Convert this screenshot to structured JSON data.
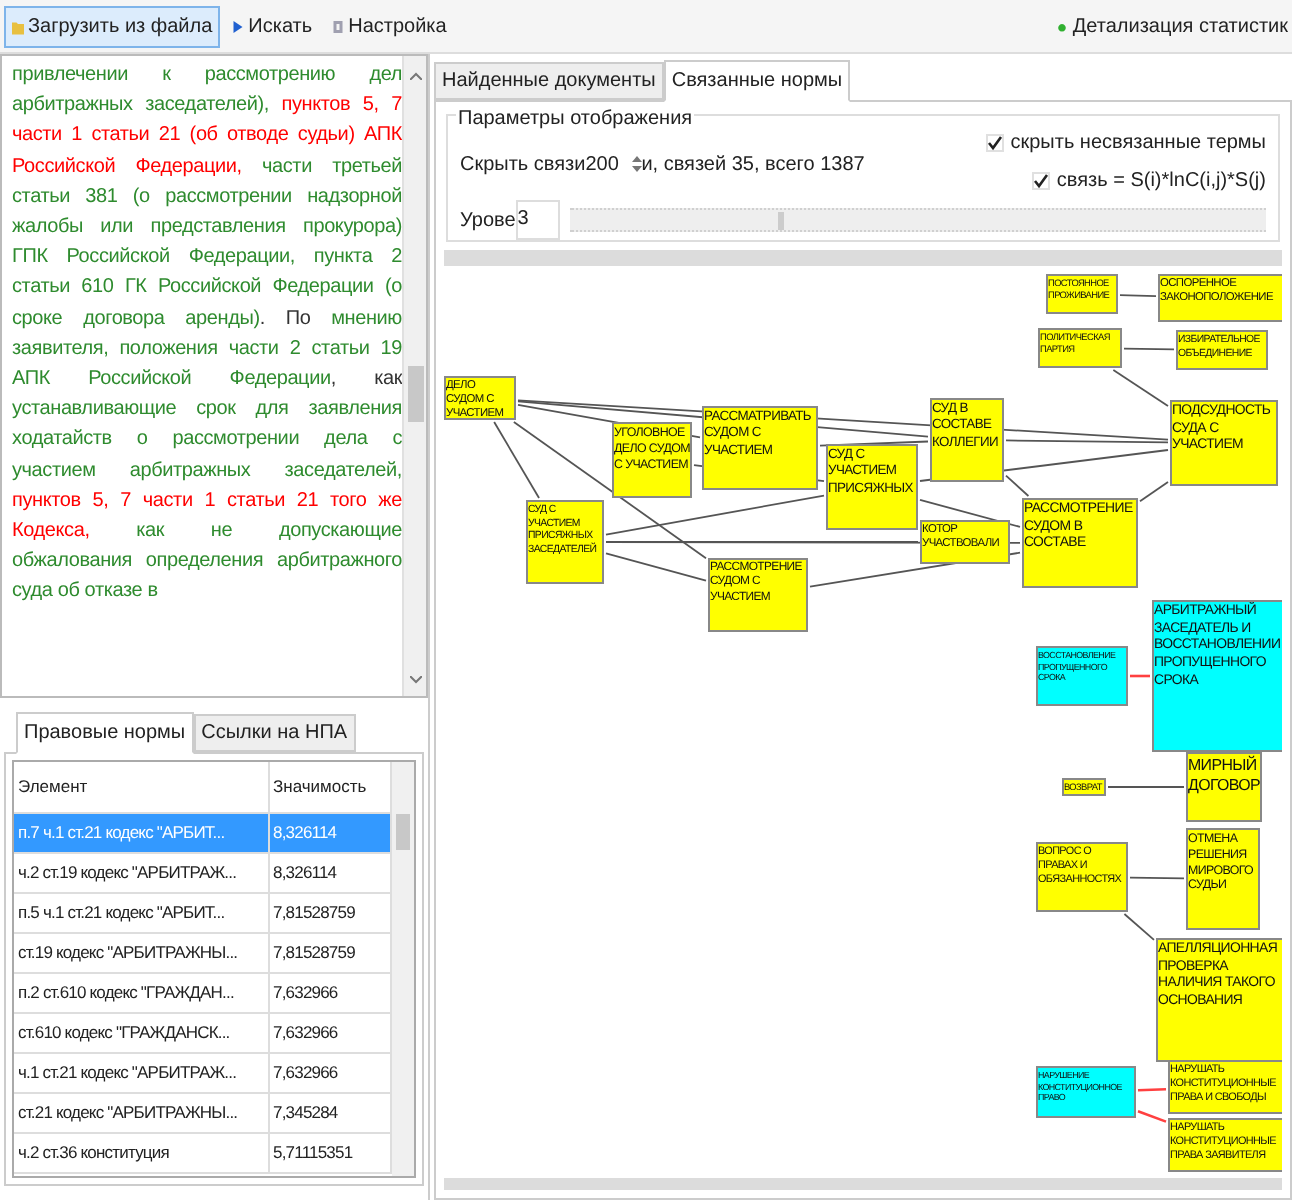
{
  "toolbar": {
    "buttons": [
      {
        "label": "Загрузить из файла",
        "selected": true
      },
      {
        "label": "Искать",
        "selected": false
      },
      {
        "label": "Настройка",
        "selected": false
      }
    ],
    "right_button": {
      "label": "Детализация статистик"
    }
  },
  "document_text": {
    "segments": [
      {
        "text": "привлечении к рассмотрению дел арбитражных заседателей), ",
        "color": "#2e8b2e"
      },
      {
        "text": "пунктов 5, 7 части 1 статьи 21 (об отводе судьи) АПК Российской Федерации, ",
        "color": "#ff0000"
      },
      {
        "text": "части третьей статьи 381 (о рассмотрении надзорной жалобы или представления прокурора) ГПК Российской Федерации, ",
        "color": "#2e8b2e"
      },
      {
        "text": "пункта 2 статьи 610 ГК Российской Федерации (о сроке договора аренды)",
        "color": "#2e8b2e"
      },
      {
        "text": ". По ",
        "color": "#333333"
      },
      {
        "text": "мнению заявителя, положения части 2 статьи 19 АПК Российской Федерации",
        "color": "#2e8b2e"
      },
      {
        "text": ", как ",
        "color": "#333333"
      },
      {
        "text": "устанавливающие срок для заявления ходатайств о рассмотрении дела с участием арбитражных заседателей, ",
        "color": "#2e8b2e"
      },
      {
        "text": "пунктов 5, 7 части 1 статьи 21 того же Кодекса, ",
        "color": "#ff0000"
      },
      {
        "text": "как не допускающие обжалования определения арбитражного суда об отказе в",
        "color": "#2e8b2e"
      }
    ]
  },
  "left_tabs": [
    {
      "label": "Правовые нормы",
      "selected": true
    },
    {
      "label": "Ссылки на НПА",
      "selected": false
    }
  ],
  "table": {
    "columns": [
      "Элемент",
      "Значимость"
    ],
    "rows": [
      {
        "cells": [
          "п.7 ч.1 ст.21 кодекс \"АРБИТ...",
          "8,326114"
        ],
        "selected": true
      },
      {
        "cells": [
          "ч.2 ст.19 кодекс \"АРБИТРАЖ...",
          "8,326114"
        ],
        "selected": false
      },
      {
        "cells": [
          "п.5 ч.1 ст.21 кодекс \"АРБИТ...",
          "7,81528759"
        ],
        "selected": false
      },
      {
        "cells": [
          "ст.19 кодекс \"АРБИТРАЖНЫ...",
          "7,81528759"
        ],
        "selected": false
      },
      {
        "cells": [
          "п.2 ст.610 кодекс \"ГРАЖДАН...",
          "7,632966"
        ],
        "selected": false
      },
      {
        "cells": [
          "ст.610 кодекс \"ГРАЖДАНСК...",
          "7,632966"
        ],
        "selected": false
      },
      {
        "cells": [
          "ч.1 ст.21 кодекс \"АРБИТРАЖ...",
          "7,632966"
        ],
        "selected": false
      },
      {
        "cells": [
          "ст.21 кодекс \"АРБИТРАЖНЫ...",
          "7,345284"
        ],
        "selected": false
      },
      {
        "cells": [
          "ч.2 ст.36 конституция",
          "5,71115351"
        ],
        "selected": false
      }
    ]
  },
  "right_tabs": [
    {
      "label": "Найденные документы",
      "selected": false
    },
    {
      "label": "Связанные нормы",
      "selected": true
    }
  ],
  "display_params": {
    "title": "Параметры отображения",
    "hide_links_label": "Скрыть связи",
    "hide_links_value": "200",
    "links_info": "и, связей 35, всего 1387",
    "level_label": "Урове",
    "level_value": "3",
    "slider": {
      "level": 0.3
    },
    "checkboxes": [
      {
        "label": "скрыть несвязанные термы",
        "checked": true
      },
      {
        "label": "связь = S(i)*lnC(i,j)*S(j)",
        "checked": true
      }
    ]
  },
  "graph": {
    "nodes": [
      {
        "label": "ПОСТОЯННОЕ ПРОЖИВАНИЕ",
        "color": "#ffff00"
      },
      {
        "label": "ОСПОРЕННОЕ ЗАКОНОПОЛОЖЕНИЕ",
        "color": "#ffff00"
      },
      {
        "label": "ПОЛИТИЧЕСКАЯ ПАРТИЯ",
        "color": "#ffff00"
      },
      {
        "label": "ИЗБИРАТЕЛЬНОЕ ОБЪЕДИНЕНИЕ",
        "color": "#ffff00"
      },
      {
        "label": "ДЕЛО СУДОМ С УЧАСТИЕМ",
        "color": "#ffff00"
      },
      {
        "label": "УГОЛОВНОЕ ДЕЛО СУДОМ С УЧАСТИЕМ",
        "color": "#ffff00"
      },
      {
        "label": "РАССМАТРИВАТЬ СУДОМ С УЧАСТИЕМ",
        "color": "#ffff00"
      },
      {
        "label": "СУД В СОСТАВЕ КОЛЛЕГИИ",
        "color": "#ffff00"
      },
      {
        "label": "ПОДСУДНОСТЬ СУДА С УЧАСТИЕМ",
        "color": "#ffff00"
      },
      {
        "label": "СУД С УЧАСТИЕМ ПРИСЯЖНЫХ",
        "color": "#ffff00"
      },
      {
        "label": "СУД С УЧАСТИЕМ ПРИСЯЖНЫХ ЗАСЕДАТЕЛЕЙ",
        "color": "#ffff00"
      },
      {
        "label": "КОТОР УЧАСТВОВАЛИ",
        "color": "#ffff00"
      },
      {
        "label": "РАССМОТРЕНИЕ СУДОМ В СОСТАВЕ",
        "color": "#ffff00"
      },
      {
        "label": "РАССМОТРЕНИЕ СУДОМ С УЧАСТИЕМ",
        "color": "#ffff00"
      },
      {
        "label": "ВОССТАНОВЛЕНИЕ ПРОПУЩЕННОГО СРОКА",
        "color": "#00ffff"
      },
      {
        "label": "АРБИТРАЖНЫЙ ЗАСЕДАТЕЛЬ И ВОССТАНОВЛЕНИИ ПРОПУЩЕННОГО СРОКА",
        "color": "#00ffff"
      },
      {
        "label": "ВОЗВРАТ",
        "color": "#ffff00"
      },
      {
        "label": "МИРНЫЙ ДОГОВОР",
        "color": "#ffff00"
      },
      {
        "label": "ВОПРОС О ПРАВАХ И ОБЯЗАННОСТЯХ",
        "color": "#ffff00"
      },
      {
        "label": "ОТМЕНА РЕШЕНИЯ МИРОВОГО СУДЬИ",
        "color": "#ffff00"
      },
      {
        "label": "АПЕЛЛЯЦИОННАЯ ПРОВЕРКА НАЛИЧИЯ ТАКОГО ОСНОВАНИЯ",
        "color": "#ffff00"
      },
      {
        "label": "НАРУШЕНИЕ КОНСТИТУЦИОННОЕ ПРАВО",
        "color": "#00ffff"
      },
      {
        "label": "НАРУШАТЬ КОНСТИТУЦИОННЫЕ ПРАВА И СВОБОДЫ",
        "color": "#ffff00"
      },
      {
        "label": "НАРУШАТЬ КОНСТИТУЦИОННЫЕ ПРАВА ЗАЯВИТЕЛЯ",
        "color": "#ffff00"
      }
    ]
  }
}
